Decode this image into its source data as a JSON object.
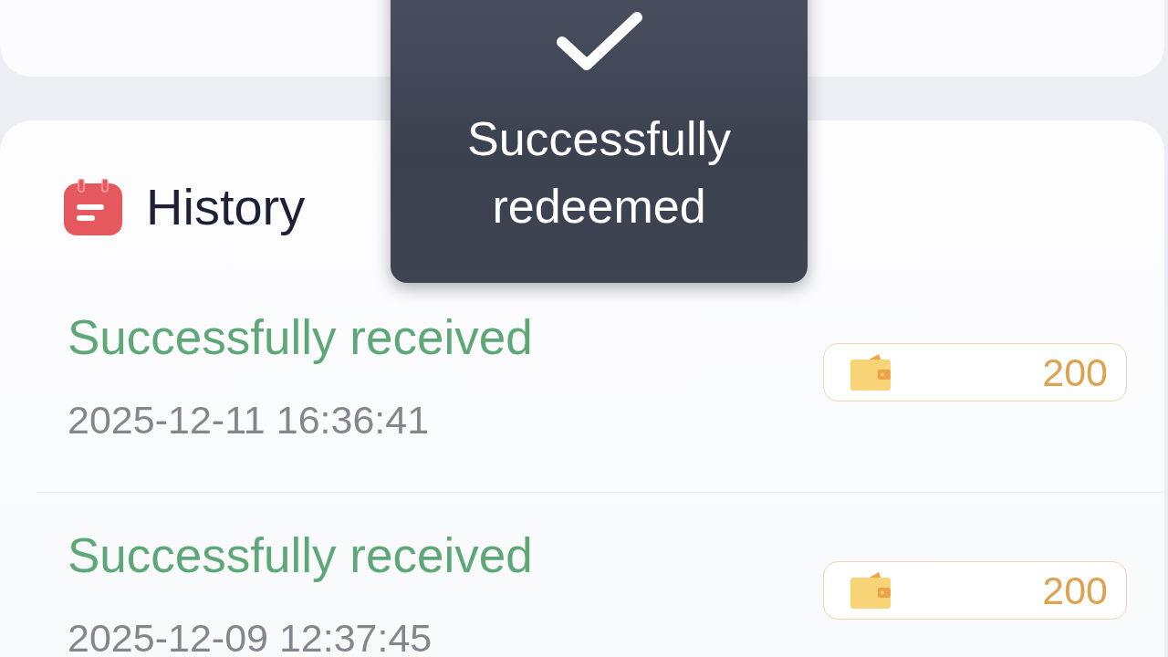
{
  "toast": {
    "message": "Successfully redeemed"
  },
  "history": {
    "title": "History",
    "records": [
      {
        "status": "Successfully received",
        "time": "2025-12-11 16:36:41",
        "amount": "200"
      },
      {
        "status": "Successfully received",
        "time": "2025-12-09 12:37:45",
        "amount": "200"
      }
    ]
  }
}
